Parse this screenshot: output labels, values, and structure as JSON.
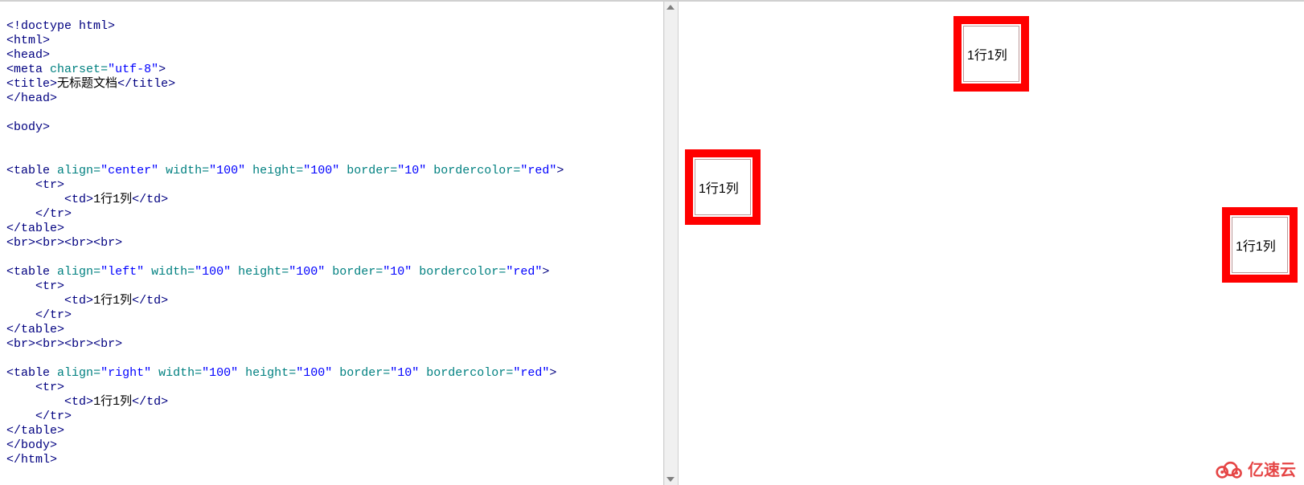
{
  "code": {
    "doctype": "!doctype html",
    "html_open": "html",
    "head_open": "head",
    "meta_tag": "meta",
    "meta_attr_name": "charset",
    "meta_attr_val": "\"utf-8\"",
    "title_open": "title",
    "title_text": "无标题文档",
    "title_close": "/title",
    "head_close": "/head",
    "body_open": "body",
    "table_tag": "table",
    "tr_open": "tr",
    "tr_close": "/tr",
    "td_open": "td",
    "td_close": "/td",
    "td_text": "1行1列",
    "table_close": "/table",
    "br_tag": "br",
    "body_close": "/body",
    "html_close": "/html",
    "attrs": {
      "align": "align",
      "width": "width",
      "height": "height",
      "border": "border",
      "bordercolor": "bordercolor"
    },
    "vals": {
      "center": "\"center\"",
      "left": "\"left\"",
      "right": "\"right\"",
      "w100": "\"100\"",
      "h100": "\"100\"",
      "b10": "\"10\"",
      "red": "\"red\""
    }
  },
  "preview": {
    "cell_text": "1行1列",
    "tables": [
      {
        "align": "center"
      },
      {
        "align": "left"
      },
      {
        "align": "right"
      }
    ]
  },
  "watermark": {
    "text": "亿速云"
  }
}
